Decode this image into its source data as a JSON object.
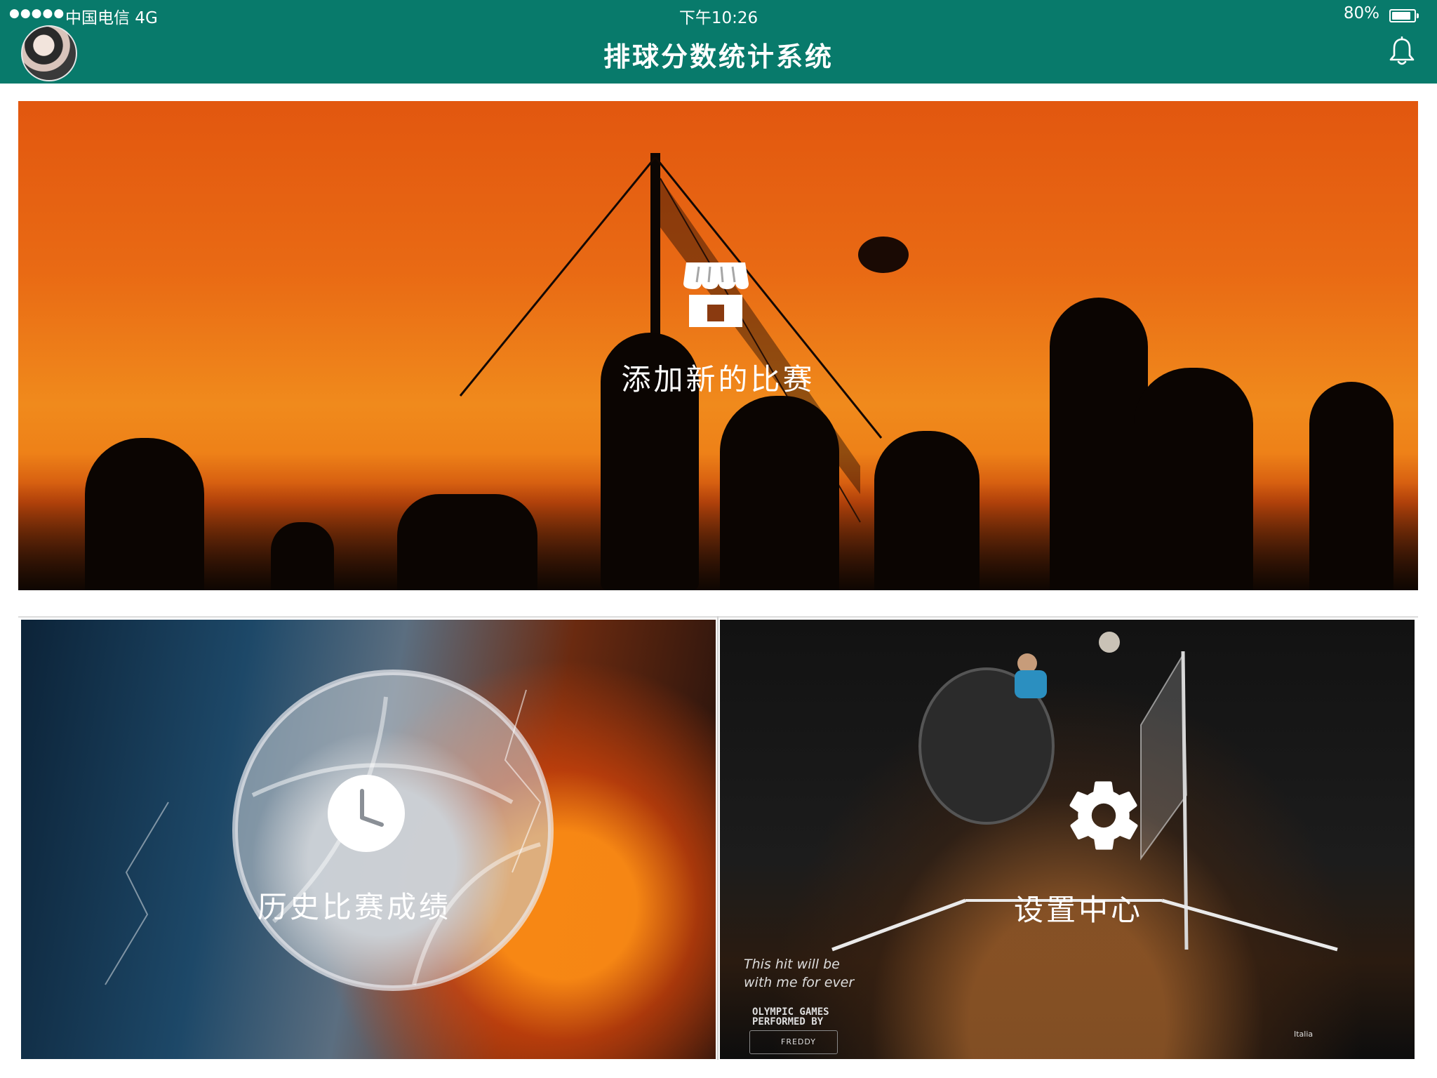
{
  "status_bar": {
    "signal": "●●●●●",
    "carrier": "中国电信 4G",
    "time": "下午10:26",
    "battery": "80%"
  },
  "header": {
    "title": "排球分数统计系统"
  },
  "tiles": {
    "new_match": {
      "label": "添加新的比赛",
      "icon": "store-icon"
    },
    "history": {
      "label": "历史比赛成绩",
      "icon": "clock-icon"
    },
    "settings": {
      "label": "设置中心",
      "icon": "gear-icon"
    }
  },
  "ad": {
    "handwriting_1": "This hit will be",
    "handwriting_2": "with me for ever",
    "line1": "OLYMPIC GAMES",
    "line2": "PERFORMED BY",
    "brand": "FREDDY",
    "corner": "Italia"
  },
  "colors": {
    "header_bg": "#087a6b",
    "text_on_header": "#ffffff"
  }
}
